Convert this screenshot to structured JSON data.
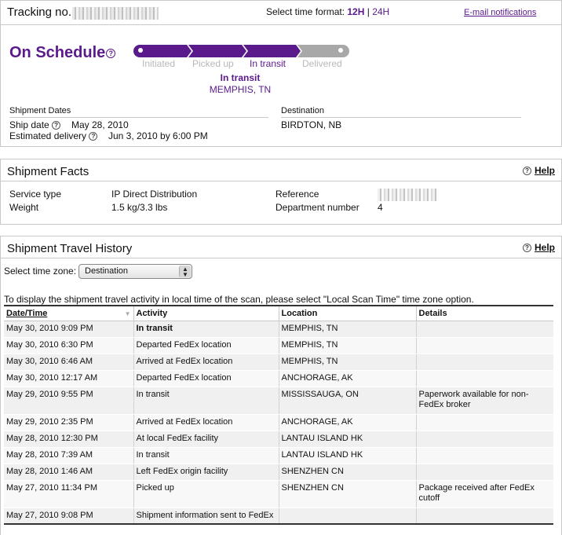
{
  "header": {
    "tracking_label": "Tracking no.",
    "time_format_label": "Select time format:",
    "fmt_12h": "12H",
    "fmt_separator": "|",
    "fmt_24h": "24H",
    "email_link": "E-mail notifications"
  },
  "status": {
    "title": "On Schedule",
    "help_glyph": "?",
    "steps": [
      "Initiated",
      "Picked up",
      "In transit",
      "Delivered"
    ],
    "current_step": 2,
    "current_status": "In transit",
    "current_location": "MEMPHIS, TN"
  },
  "dates": {
    "heading": "Shipment Dates",
    "ship_date_label": "Ship date",
    "ship_date": "May 28, 2010",
    "est_delivery_label": "Estimated delivery",
    "est_delivery": "Jun 3, 2010 by 6:00 PM"
  },
  "destination": {
    "heading": "Destination",
    "value": "BIRDTON, NB"
  },
  "facts": {
    "title": "Shipment Facts",
    "help": "Help",
    "service_type_label": "Service type",
    "service_type": "IP Direct Distribution",
    "weight_label": "Weight",
    "weight": "1.5 kg/3.3 lbs",
    "reference_label": "Reference",
    "department_label": "Department number",
    "department": "4"
  },
  "history": {
    "title": "Shipment Travel History",
    "help": "Help",
    "tz_label": "Select time zone:",
    "tz_value": "Destination",
    "notice": "To display the shipment travel activity in local time of the scan, please select \"Local Scan Time\" time zone option.",
    "columns": [
      "Date/Time",
      "Activity",
      "Location",
      "Details"
    ],
    "rows": [
      {
        "datetime": "May 30, 2010 9:09 PM",
        "activity": "In transit",
        "location": "MEMPHIS, TN",
        "details": ""
      },
      {
        "datetime": "May 30, 2010 6:30 PM",
        "activity": "Departed FedEx location",
        "location": "MEMPHIS, TN",
        "details": ""
      },
      {
        "datetime": "May 30, 2010 6:46 AM",
        "activity": "Arrived at FedEx location",
        "location": "MEMPHIS, TN",
        "details": ""
      },
      {
        "datetime": "May 30, 2010 12:17 AM",
        "activity": "Departed FedEx location",
        "location": "ANCHORAGE, AK",
        "details": ""
      },
      {
        "datetime": "May 29, 2010 9:55 PM",
        "activity": "In transit",
        "location": "MISSISSAUGA, ON",
        "details": "Paperwork available for non-FedEx broker"
      },
      {
        "datetime": "May 29, 2010 2:35 PM",
        "activity": "Arrived at FedEx location",
        "location": "ANCHORAGE, AK",
        "details": ""
      },
      {
        "datetime": "May 28, 2010 12:30 PM",
        "activity": "At local FedEx facility",
        "location": "LANTAU ISLAND HK",
        "details": ""
      },
      {
        "datetime": "May 28, 2010 7:39 AM",
        "activity": "In transit",
        "location": "LANTAU ISLAND HK",
        "details": ""
      },
      {
        "datetime": "May 28, 2010 1:46 AM",
        "activity": "Left FedEx origin facility",
        "location": "SHENZHEN CN",
        "details": ""
      },
      {
        "datetime": "May 27, 2010 11:34 PM",
        "activity": "Picked up",
        "location": "SHENZHEN CN",
        "details": "Package received after FedEx cutoff"
      },
      {
        "datetime": "May 27, 2010 9:08 PM",
        "activity": "Shipment information sent to FedEx",
        "location": "",
        "details": ""
      }
    ]
  },
  "colors": {
    "brand_purple": "#5a1a8c",
    "inactive_gray": "#a8a8a8"
  }
}
